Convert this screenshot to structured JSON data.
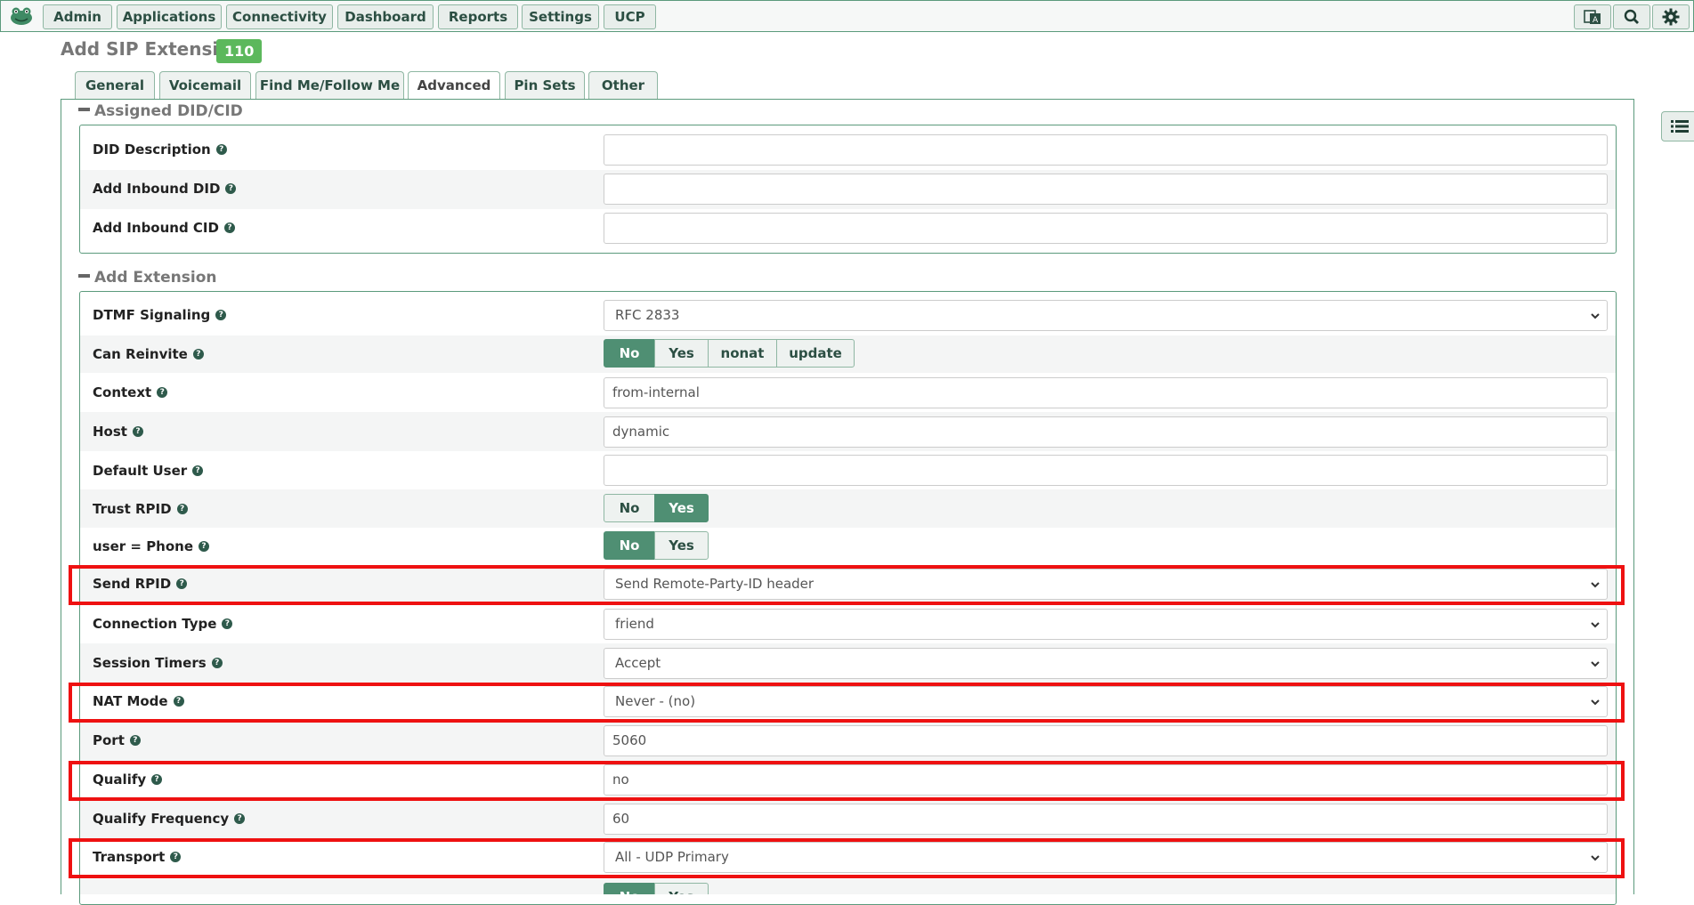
{
  "nav": {
    "menu": [
      "Admin",
      "Applications",
      "Connectivity",
      "Dashboard",
      "Reports",
      "Settings",
      "UCP"
    ],
    "tool_icons": [
      "language-icon",
      "search-icon",
      "gear-icon"
    ]
  },
  "page": {
    "title": "Add SIP Extension",
    "badge": "110"
  },
  "tabs": [
    "General",
    "Voicemail",
    "Find Me/Follow Me",
    "Advanced",
    "Pin Sets",
    "Other"
  ],
  "active_tab": "Advanced",
  "did_section": {
    "title": "Assigned DID/CID",
    "fields": [
      {
        "label": "DID Description",
        "value": ""
      },
      {
        "label": "Add Inbound DID",
        "value": ""
      },
      {
        "label": "Add Inbound CID",
        "value": ""
      }
    ]
  },
  "ext_section": {
    "title": "Add Extension",
    "dtmf": {
      "label": "DTMF Signaling",
      "value": "RFC 2833"
    },
    "can_reinvite": {
      "label": "Can Reinvite",
      "options": [
        "No",
        "Yes",
        "nonat",
        "update"
      ],
      "selected": "No"
    },
    "context": {
      "label": "Context",
      "value": "from-internal"
    },
    "host": {
      "label": "Host",
      "value": "dynamic"
    },
    "default_user": {
      "label": "Default User",
      "value": ""
    },
    "trust_rpid": {
      "label": "Trust RPID",
      "options": [
        "No",
        "Yes"
      ],
      "selected": "Yes"
    },
    "user_phone": {
      "label": "user = Phone",
      "options": [
        "No",
        "Yes"
      ],
      "selected": "No"
    },
    "send_rpid": {
      "label": "Send RPID",
      "value": "Send Remote-Party-ID header"
    },
    "connection_type": {
      "label": "Connection Type",
      "value": "friend"
    },
    "session_timers": {
      "label": "Session Timers",
      "value": "Accept"
    },
    "nat_mode": {
      "label": "NAT Mode",
      "value": "Never - (no)"
    },
    "port": {
      "label": "Port",
      "value": "5060"
    },
    "qualify": {
      "label": "Qualify",
      "value": "no"
    },
    "qualify_freq": {
      "label": "Qualify Frequency",
      "value": "60"
    },
    "transport": {
      "label": "Transport",
      "value": "All - UDP Primary"
    },
    "next_options": [
      "No",
      "Yes"
    ]
  },
  "colors": {
    "accent": "#4f8f73",
    "highlight": "#ee1111",
    "badge": "#5cb85c"
  }
}
